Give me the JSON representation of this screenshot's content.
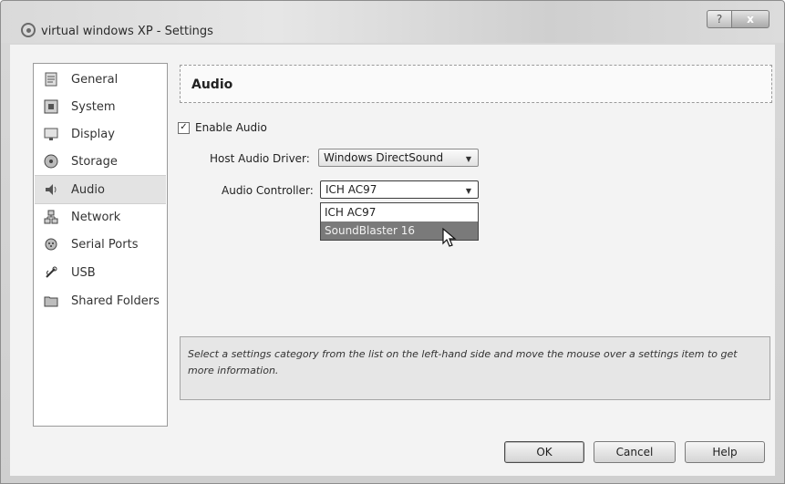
{
  "window": {
    "title": "virtual windows XP - Settings",
    "help_glyph": "?",
    "close_glyph": "x"
  },
  "sidebar": {
    "items": [
      {
        "label": "General",
        "icon": "general-icon"
      },
      {
        "label": "System",
        "icon": "system-icon"
      },
      {
        "label": "Display",
        "icon": "display-icon"
      },
      {
        "label": "Storage",
        "icon": "storage-icon"
      },
      {
        "label": "Audio",
        "icon": "audio-icon",
        "selected": true
      },
      {
        "label": "Network",
        "icon": "network-icon"
      },
      {
        "label": "Serial Ports",
        "icon": "serial-ports-icon"
      },
      {
        "label": "USB",
        "icon": "usb-icon"
      },
      {
        "label": "Shared Folders",
        "icon": "shared-folders-icon"
      }
    ]
  },
  "main": {
    "header_title": "Audio",
    "enable_audio": {
      "label": "Enable Audio",
      "checked": true,
      "check_glyph": "✓"
    },
    "host_driver": {
      "label": "Host Audio Driver:",
      "value": "Windows DirectSound"
    },
    "audio_controller": {
      "label": "Audio Controller:",
      "value": "ICH AC97",
      "options": [
        "ICH AC97",
        "SoundBlaster 16"
      ],
      "highlighted": "SoundBlaster 16"
    },
    "info_text": "Select a settings category from the list on the left-hand side and move the mouse over a settings item to get more information."
  },
  "buttons": {
    "ok": "OK",
    "cancel": "Cancel",
    "help": "Help"
  }
}
